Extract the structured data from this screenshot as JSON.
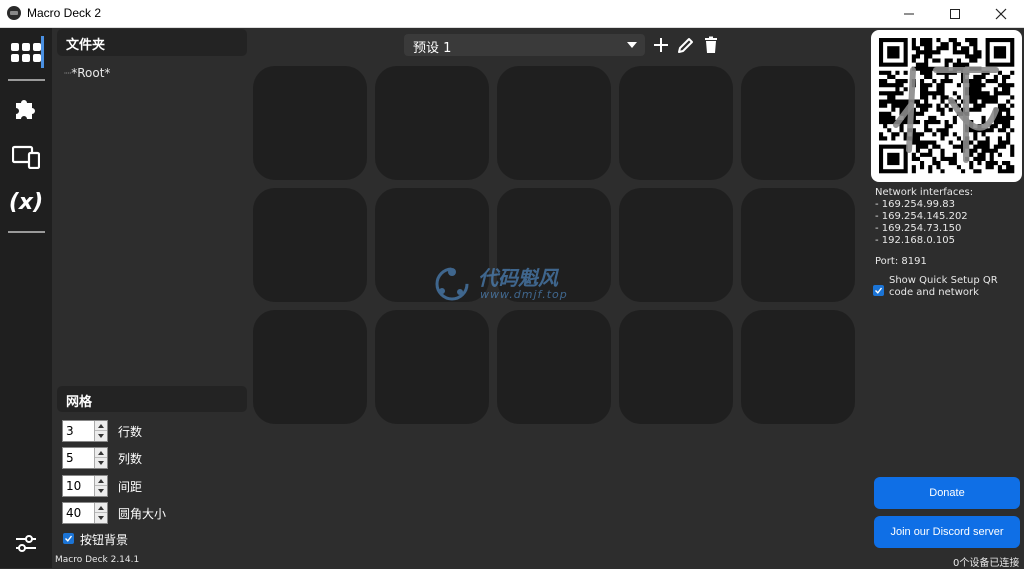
{
  "window": {
    "title": "Macro Deck 2"
  },
  "sidebar": {
    "items": [
      {
        "icon": "grid-icon"
      },
      {
        "icon": "puzzle-icon"
      },
      {
        "icon": "devices-icon"
      },
      {
        "icon": "variables-icon",
        "label": "(x)"
      },
      {
        "icon": "settings-sliders-icon"
      }
    ]
  },
  "folders": {
    "header": "文件夹",
    "root": "*Root*"
  },
  "grid_settings": {
    "header": "网格",
    "rows": {
      "value": "3",
      "label": "行数"
    },
    "columns": {
      "value": "5",
      "label": "列数"
    },
    "spacing": {
      "value": "10",
      "label": "间距"
    },
    "corner_radius": {
      "value": "40",
      "label": "圆角大小"
    },
    "button_background": {
      "label": "按钮背景",
      "checked": true
    }
  },
  "version": "Macro Deck 2.14.1",
  "preset": {
    "selected": "预设 1"
  },
  "grid": {
    "rows": 3,
    "columns": 5
  },
  "network": {
    "header": "Network interfaces:",
    "interfaces": [
      "- 169.254.99.83",
      "- 169.254.145.202",
      "- 169.254.73.150",
      "- 192.168.0.105"
    ],
    "port": "Port: 8191",
    "show_qr_label_1": "Show Quick Setup QR",
    "show_qr_label_2": "code and network",
    "show_qr_checked": true
  },
  "buttons": {
    "donate": "Donate",
    "discord": "Join our Discord server"
  },
  "status": {
    "connected": "0个设备已连接"
  },
  "watermark": {
    "text1": "代码魁风",
    "text2": "www.dmjf.top"
  },
  "colors": {
    "accent": "#0f6fe6",
    "sidebar_bg": "#1f1f1f",
    "main_bg": "#2d2d2d",
    "cell_bg": "#1f1f1f"
  }
}
